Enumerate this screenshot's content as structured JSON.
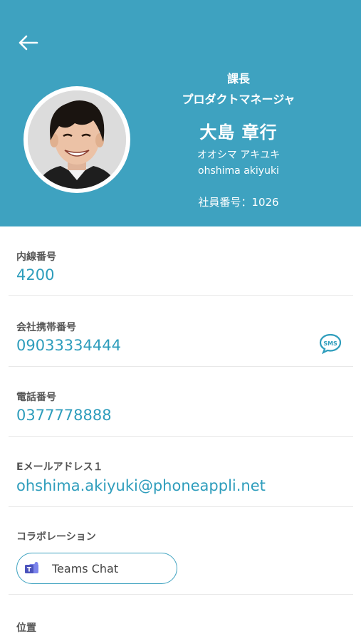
{
  "header": {
    "back_icon": "arrow-left-icon",
    "position_title": "課長",
    "job_title": "プロダクトマネージャ",
    "name": "大島 章行",
    "name_kana": "オオシマ アキユキ",
    "name_roman": "ohshima akiyuki",
    "employee_number": "社員番号：1026",
    "background_color": "#3ea2c0"
  },
  "fields": {
    "extension": {
      "label": "内線番号",
      "value": "4200"
    },
    "mobile": {
      "label": "会社携帯番号",
      "value": "09033334444",
      "sms_icon": "sms-icon"
    },
    "phone": {
      "label": "電話番号",
      "value": "0377778888"
    },
    "email": {
      "label": "Eメールアドレス１",
      "value": "ohshima.akiyuki@phoneappli.net"
    },
    "collaboration": {
      "label": "コラボレーション",
      "teams_label": "Teams Chat",
      "teams_icon": "teams-icon"
    },
    "location": {
      "label": "位置"
    }
  },
  "accent_color": "#2e9dbc"
}
